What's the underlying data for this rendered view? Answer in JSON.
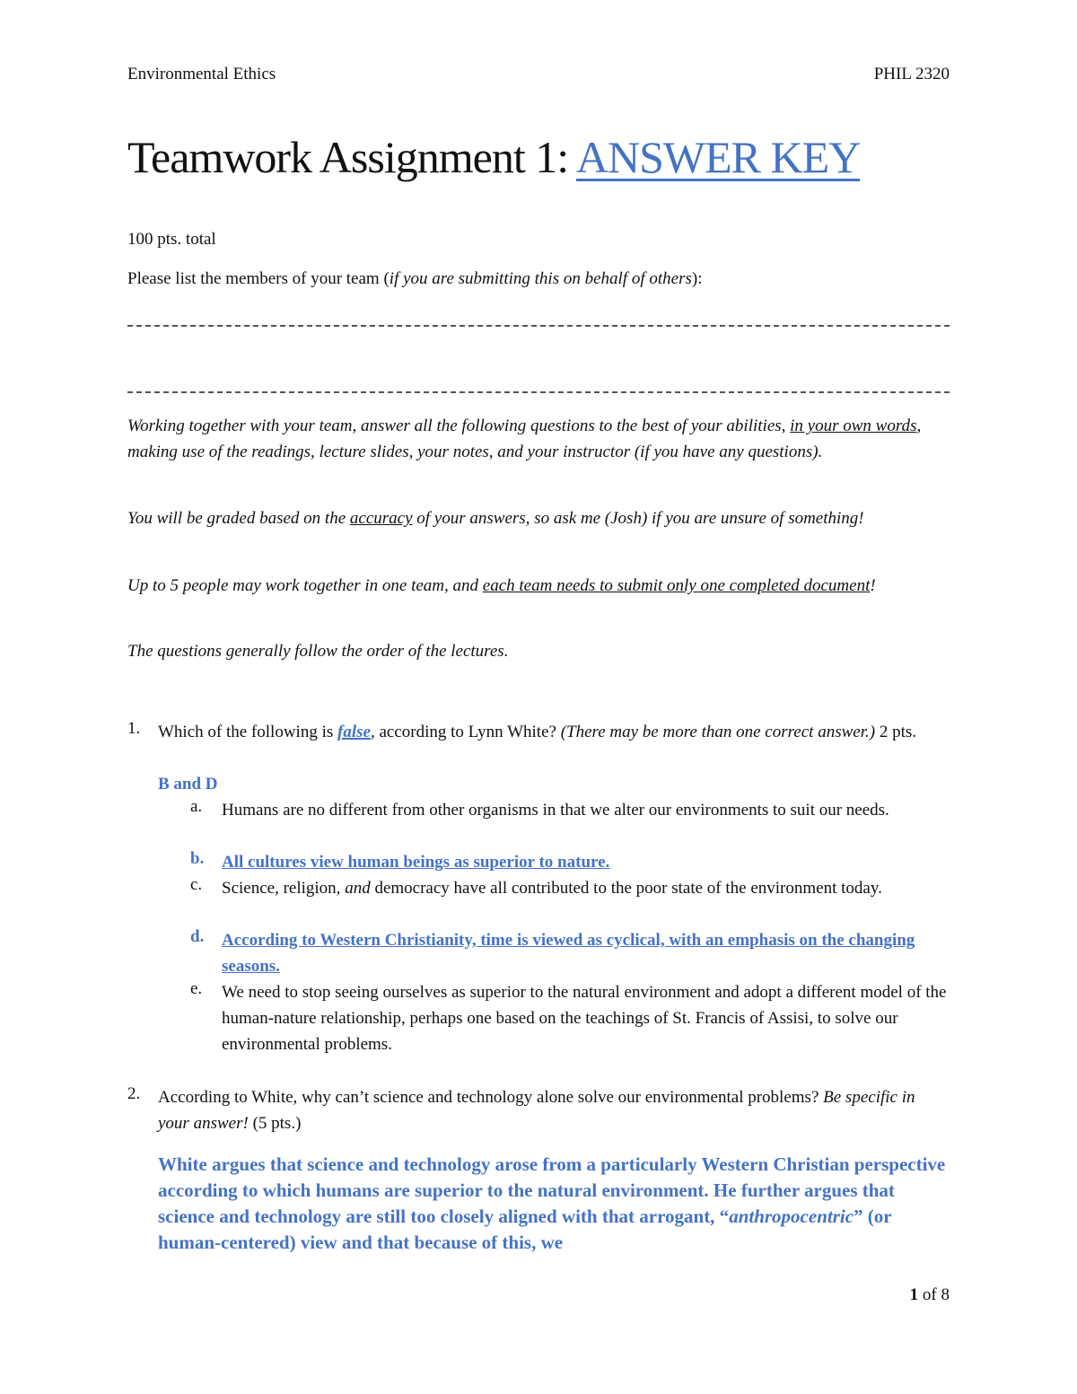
{
  "header": {
    "course_name": "Environmental Ethics",
    "course_code": "PHIL 2320"
  },
  "title": {
    "main": "Teamwork Assignment 1: ",
    "highlight": "ANSWER KEY"
  },
  "points_total": "100 pts. total",
  "team_prompt": {
    "text": "Please list the members of your team (",
    "italic": "if you are submitting this on behalf of others",
    "end": "):"
  },
  "instructions": {
    "p1_a": "Working together with your team, answer all the following questions to the best of your abilities, ",
    "p1_u": "in your own words",
    "p1_b": ", making use of the readings, lecture slides, your notes, and your instructor (if you have any questions).",
    "p2_a": "You will be graded based on the ",
    "p2_u": "accuracy",
    "p2_b": " of your answers, so ask me (Josh) if you are unsure of something!",
    "p3_a": "Up to 5 people may work together in one team, and ",
    "p3_u": "each team needs to submit only one completed document",
    "p3_b": "!",
    "p4": "The questions generally follow the order of the lectures."
  },
  "questions": [
    {
      "number": "1.",
      "text_a": "Which of the following is ",
      "emphasis": "false",
      "text_b": ", according to Lynn White? ",
      "italic": "(There may be more than one correct answer.)",
      "points": " 2 pts.",
      "answer": "B and D",
      "options": [
        {
          "letter": "a.",
          "text": "Humans are no different from other organisms in that we alter our environments to suit our needs.",
          "correct": false
        },
        {
          "letter": "b.",
          "text": "All cultures view human beings as superior to nature.",
          "correct": true
        },
        {
          "letter": "c.",
          "text_a": "Science, religion, ",
          "italic": "and",
          "text_b": " democracy have all contributed to the poor state of the environment today.",
          "correct": false
        },
        {
          "letter": "d.",
          "text": "According to Western Christianity, time is viewed as cyclical, with an emphasis on the changing seasons.",
          "correct": true
        },
        {
          "letter": "e.",
          "text": "We need to stop seeing ourselves as superior to the natural environment and adopt a different model of the human-nature relationship, perhaps one based on the teachings of St. Francis of Assisi, to solve our environmental problems.",
          "correct": false
        }
      ]
    },
    {
      "number": "2.",
      "text": "According to White, why can’t science and technology alone solve our environmental problems? ",
      "italic": "Be specific in your answer!",
      "points": " (5 pts.)",
      "answer_a": "White argues that science and technology arose from a particularly Western Christian perspective according to which humans are superior to the natural environment. He further argues that science and technology are still too closely aligned with that arrogant, “",
      "answer_italic": "anthropocentric",
      "answer_b": "” (or human-centered) view and that because of this, we"
    }
  ],
  "footer": {
    "page_current": "1",
    "page_sep": " of 8"
  },
  "colors": {
    "accent_blue": "#4472c4",
    "text": "#111111"
  }
}
